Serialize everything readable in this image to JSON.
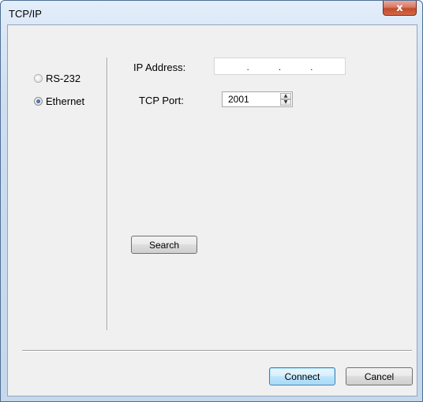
{
  "window": {
    "title": "TCP/IP",
    "close_glyph": "x"
  },
  "connection": {
    "options": [
      {
        "label": "RS-232",
        "selected": false
      },
      {
        "label": "Ethernet",
        "selected": true
      }
    ]
  },
  "form": {
    "ip_label": "IP Address:",
    "ip_dots": [
      ".",
      ".",
      "."
    ],
    "port_label": "TCP Port:",
    "port_value": "2001",
    "spinner_up": "▲",
    "spinner_down": "▼"
  },
  "buttons": {
    "search": "Search",
    "connect": "Connect",
    "cancel": "Cancel"
  }
}
